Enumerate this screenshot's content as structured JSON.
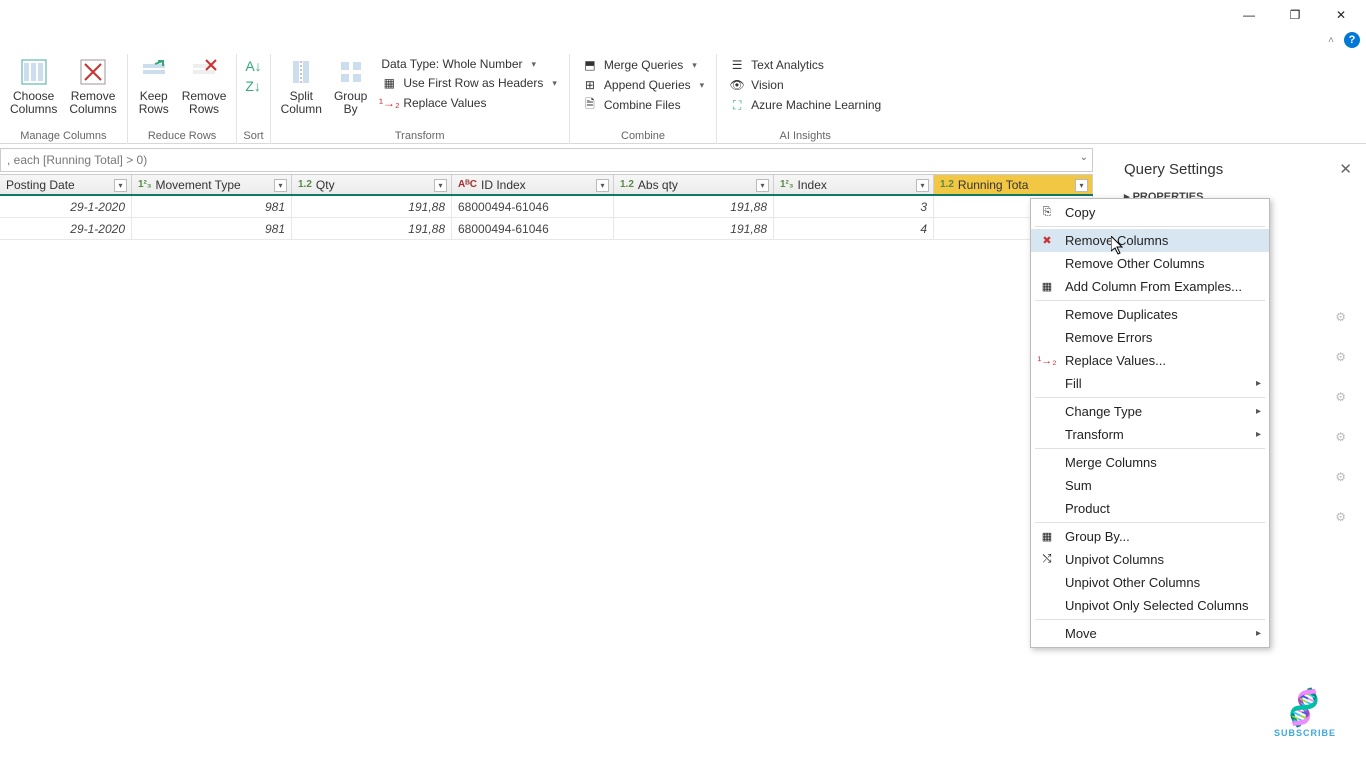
{
  "titlebar": {
    "minimize": "—",
    "maximize": "❐",
    "close": "✕"
  },
  "ribbon": {
    "manage_columns": {
      "choose": "Choose\nColumns",
      "remove": "Remove\nColumns",
      "label": "Manage Columns"
    },
    "reduce_rows": {
      "keep": "Keep\nRows",
      "remove": "Remove\nRows",
      "label": "Reduce Rows"
    },
    "sort": {
      "label": "Sort"
    },
    "split": "Split\nColumn",
    "groupby": "Group\nBy",
    "transform": {
      "datatype": "Data Type: Whole Number",
      "firstrow": "Use First Row as Headers",
      "replace": "Replace Values",
      "label": "Transform"
    },
    "combine": {
      "merge": "Merge Queries",
      "append": "Append Queries",
      "combine_files": "Combine Files",
      "label": "Combine"
    },
    "ai": {
      "text": "Text Analytics",
      "vision": "Vision",
      "aml": "Azure Machine Learning",
      "label": "AI Insights"
    }
  },
  "formula": ", each [Running Total] > 0)",
  "columns": {
    "posting_date": "Posting Date",
    "movement_type": "Movement Type",
    "qty": "Qty",
    "id_index": "ID Index",
    "abs_qty": "Abs qty",
    "index": "Index",
    "running_total": "Running Tota"
  },
  "typeprefix": {
    "int": "1²₃",
    "dec": "1.2",
    "txt": "AᴮC"
  },
  "rows": [
    {
      "posting_date": "29-1-2020",
      "movement_type": "981",
      "qty": "191,88",
      "id_index": "68000494-61046",
      "abs_qty": "191,88",
      "index": "3"
    },
    {
      "posting_date": "29-1-2020",
      "movement_type": "981",
      "qty": "191,88",
      "id_index": "68000494-61046",
      "abs_qty": "191,88",
      "index": "4"
    }
  ],
  "panel": {
    "title": "Query Settings",
    "properties": "PROPERTIES"
  },
  "ctx": {
    "copy": "Copy",
    "remove_columns": "Remove Columns",
    "remove_other": "Remove Other Columns",
    "add_from_examples": "Add Column From Examples...",
    "remove_dupes": "Remove Duplicates",
    "remove_errors": "Remove Errors",
    "replace_values": "Replace Values...",
    "fill": "Fill",
    "change_type": "Change Type",
    "transform": "Transform",
    "merge_columns": "Merge Columns",
    "sum": "Sum",
    "product": "Product",
    "group_by": "Group By...",
    "unpivot": "Unpivot Columns",
    "unpivot_other": "Unpivot Other Columns",
    "unpivot_selected": "Unpivot Only Selected Columns",
    "move": "Move"
  },
  "subscribe": "SUBSCRIBE"
}
